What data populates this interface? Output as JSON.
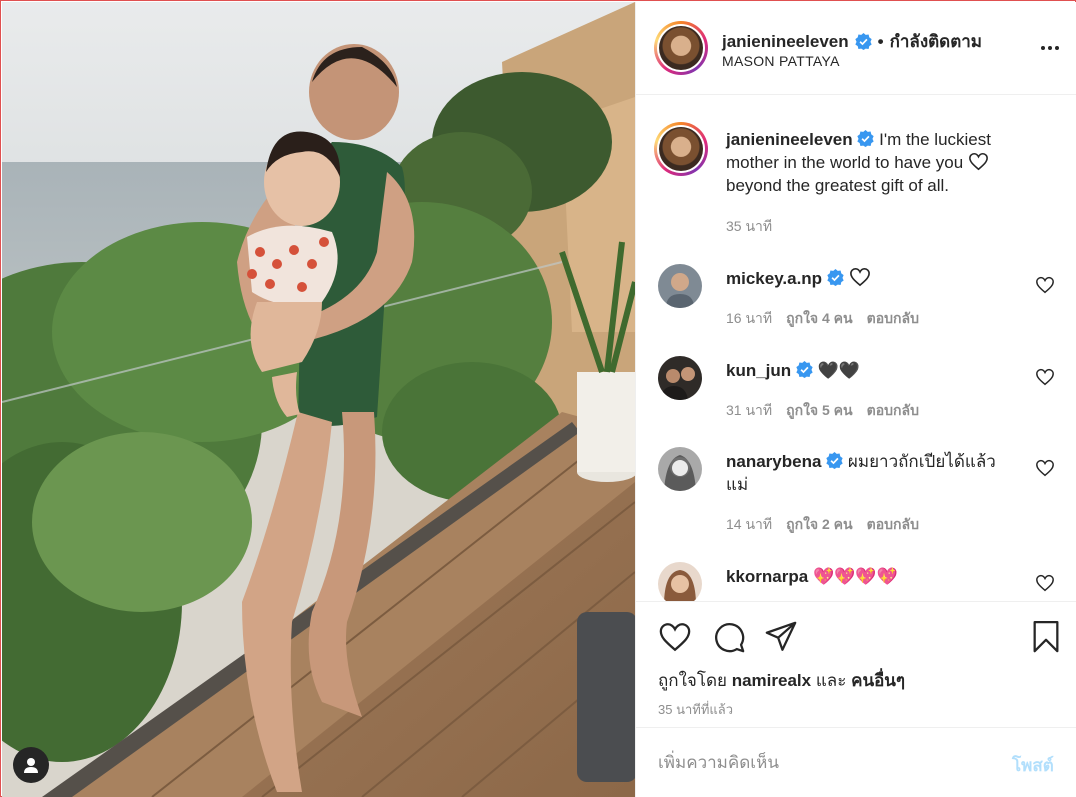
{
  "post": {
    "username": "janienineeleven",
    "follow_separator": "•",
    "follow_status": "กำลังติดตาม",
    "location": "MASON PATTAYA",
    "more_icon": "more-horizontal-icon",
    "photo_alt": "Photo by janienineeleven"
  },
  "caption": {
    "username": "janienineeleven",
    "text": "I'm the luckiest mother in the world to have you",
    "text2": "beyond the greatest gift of all.",
    "time": "35 นาที"
  },
  "comments": [
    {
      "username": "mickey.a.np",
      "text": "",
      "emoji": "white-heart",
      "time": "16 นาที",
      "likes": "ถูกใจ 4 คน",
      "reply": "ตอบกลับ",
      "avatar_color": "#6f7a86"
    },
    {
      "username": "kun_jun",
      "text": "🖤🖤",
      "time": "31 นาที",
      "likes": "ถูกใจ 5 คน",
      "reply": "ตอบกลับ",
      "avatar_color": "#3a3531"
    },
    {
      "username": "nanarybena",
      "text": "ผมยาวถักเปียได้แล้วแม่",
      "time": "14 นาที",
      "likes": "ถูกใจ 2 คน",
      "reply": "ตอบกลับ",
      "avatar_color": "#9a9a9a"
    },
    {
      "username": "kkornarpa",
      "text": "💖💖💖💖",
      "time": "",
      "likes": "",
      "reply": "",
      "avatar_color": "#caa78c"
    }
  ],
  "actions": {
    "liked_by_prefix": "ถูกใจโดย",
    "liked_by_user": "namirealx",
    "liked_by_and": "และ",
    "liked_by_others": "คนอื่นๆ",
    "timestamp": "35 นาทีที่แล้ว"
  },
  "add_comment": {
    "placeholder": "เพิ่มความคิดเห็น",
    "post_label": "โพสต์"
  },
  "colors": {
    "verified": "#3897f0",
    "post_button_disabled": "#b2dffc",
    "secondary_text": "#8e8e8e",
    "border": "#efefef"
  }
}
